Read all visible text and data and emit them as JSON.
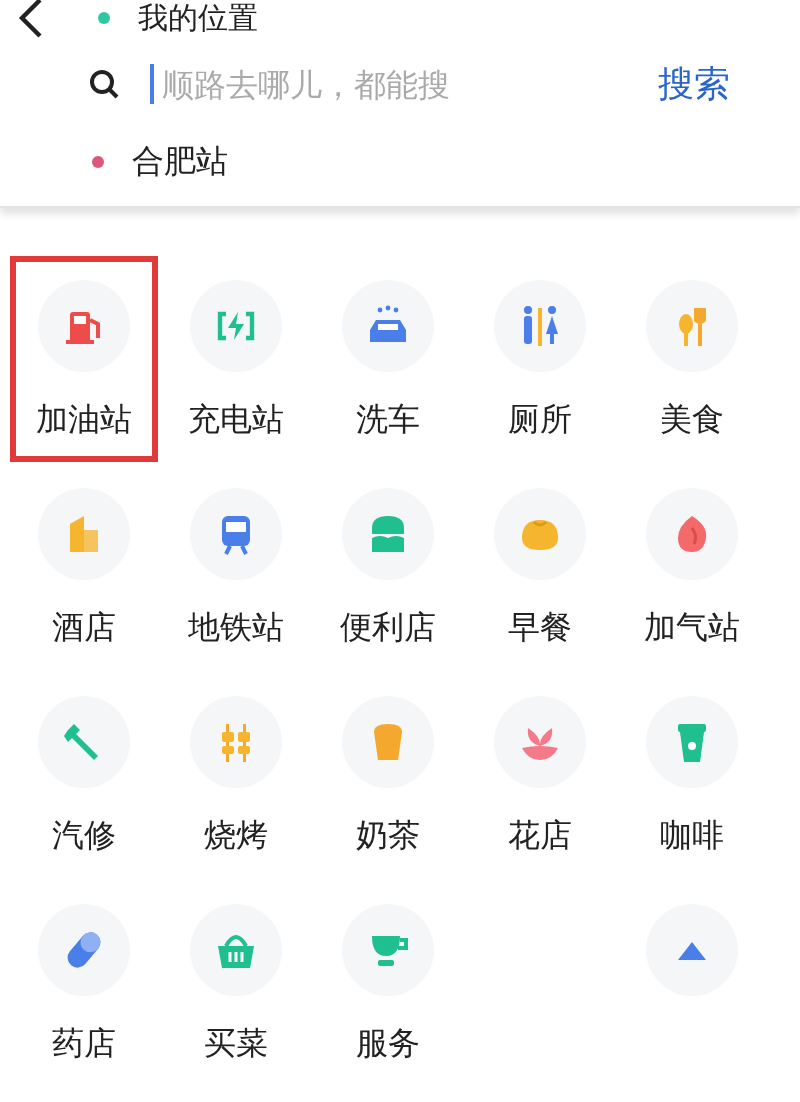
{
  "route": {
    "origin": "我的位置",
    "search": {
      "placeholder": "顺路去哪儿，都能搜",
      "button": "搜索"
    },
    "destination": "合肥站"
  },
  "categories": [
    {
      "kind": "category",
      "label": "加油站",
      "selected": true
    },
    {
      "kind": "category",
      "label": "充电站",
      "selected": false
    },
    {
      "kind": "category",
      "label": "洗车",
      "selected": false
    },
    {
      "kind": "category",
      "label": "厕所",
      "selected": false
    },
    {
      "kind": "category",
      "label": "美食",
      "selected": false
    },
    {
      "kind": "category",
      "label": "酒店",
      "selected": false
    },
    {
      "kind": "category",
      "label": "地铁站",
      "selected": false
    },
    {
      "kind": "category",
      "label": "便利店",
      "selected": false
    },
    {
      "kind": "category",
      "label": "早餐",
      "selected": false
    },
    {
      "kind": "category",
      "label": "加气站",
      "selected": false
    },
    {
      "kind": "category",
      "label": "汽修",
      "selected": false
    },
    {
      "kind": "category",
      "label": "烧烤",
      "selected": false
    },
    {
      "kind": "category",
      "label": "奶茶",
      "selected": false
    },
    {
      "kind": "category",
      "label": "花店",
      "selected": false
    },
    {
      "kind": "category",
      "label": "咖啡",
      "selected": false
    },
    {
      "kind": "category",
      "label": "药店",
      "selected": false
    },
    {
      "kind": "category",
      "label": "买菜",
      "selected": false
    },
    {
      "kind": "category",
      "label": "服务",
      "selected": false
    },
    {
      "kind": "spacer"
    },
    {
      "kind": "collapse"
    }
  ]
}
